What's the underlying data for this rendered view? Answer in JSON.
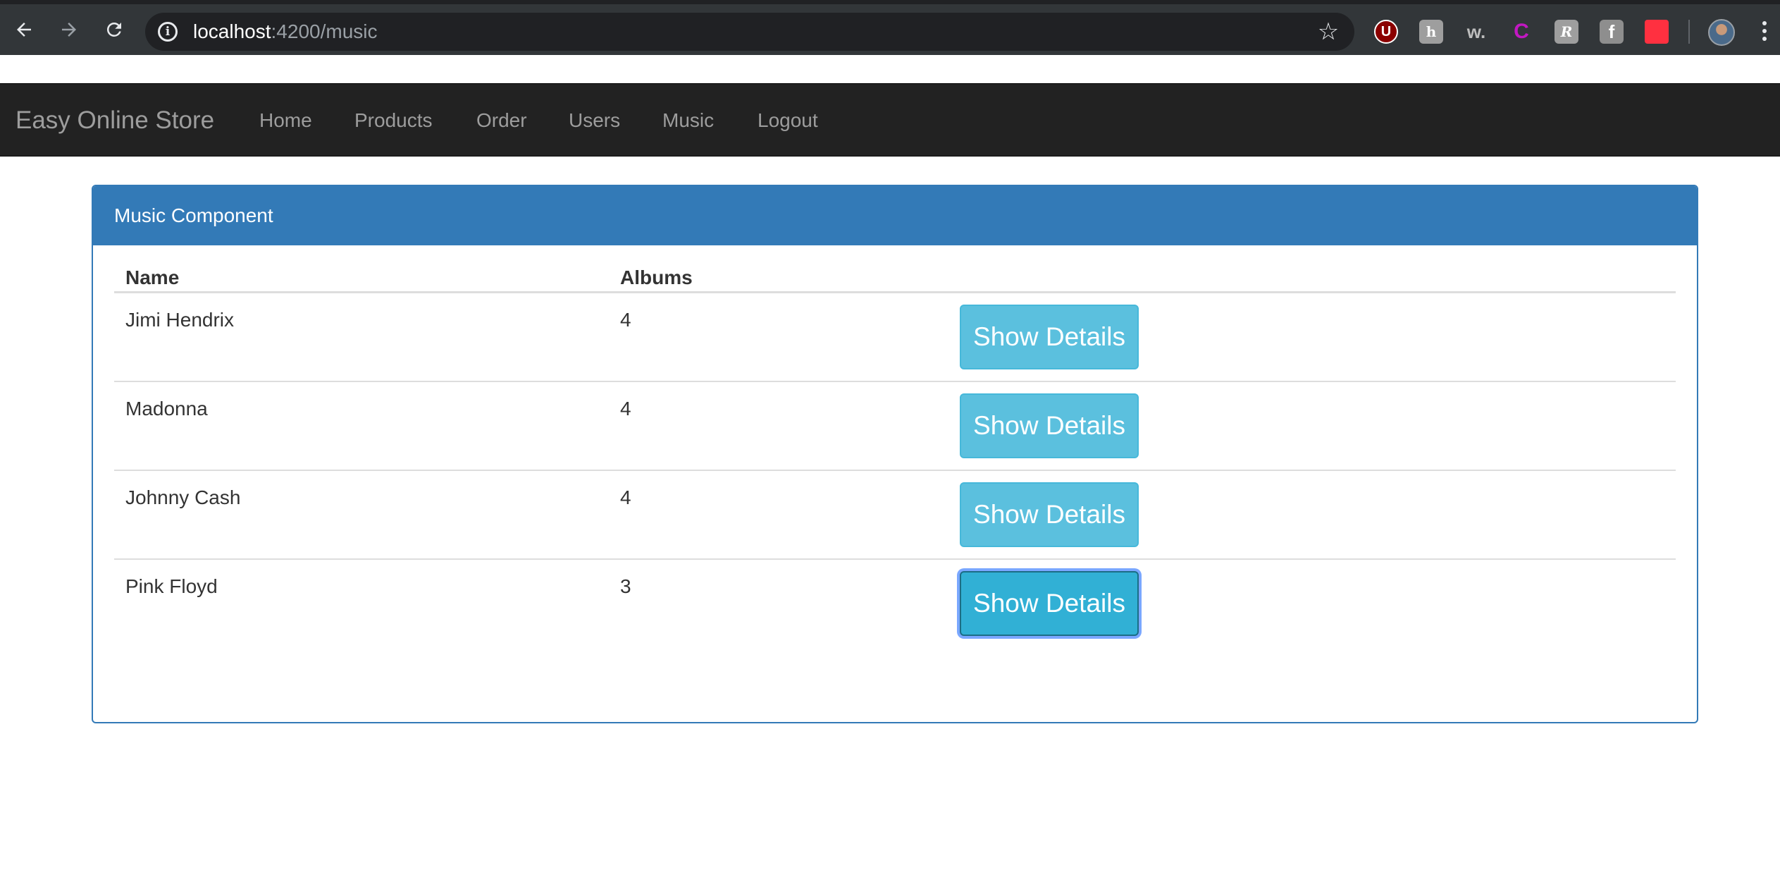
{
  "browser": {
    "url_host": "localhost",
    "url_rest": ":4200/music",
    "icons": [
      "back-arrow-icon",
      "forward-arrow-icon",
      "reload-icon",
      "info-icon",
      "bookmark-star-icon",
      "kebab-menu-icon"
    ],
    "extensions": [
      {
        "name": "ublock-extension-icon",
        "glyph": "U",
        "color": "#8b0000"
      },
      {
        "name": "h-extension-icon",
        "glyph": "h",
        "color": "#9e9e9e"
      },
      {
        "name": "w-extension-icon",
        "glyph": "w.",
        "color": "#323639"
      },
      {
        "name": "c-extension-icon",
        "glyph": "C",
        "color": "#323639"
      },
      {
        "name": "r-extension-icon",
        "glyph": "R",
        "color": "#9e9e9e"
      },
      {
        "name": "facebook-extension-icon",
        "glyph": "f",
        "color": "#8e8e8e"
      },
      {
        "name": "red-extension-icon",
        "glyph": "",
        "color": "#ff3040"
      }
    ]
  },
  "navbar": {
    "brand": "Easy Online Store",
    "links": [
      "Home",
      "Products",
      "Order",
      "Users",
      "Music",
      "Logout"
    ]
  },
  "panel": {
    "title": "Music Component",
    "columns": {
      "name": "Name",
      "albums": "Albums"
    },
    "rows": [
      {
        "name": "Jimi Hendrix",
        "albums": "4",
        "button": "Show Details"
      },
      {
        "name": "Madonna",
        "albums": "4",
        "button": "Show Details"
      },
      {
        "name": "Johnny Cash",
        "albums": "4",
        "button": "Show Details"
      },
      {
        "name": "Pink Floyd",
        "albums": "3",
        "button": "Show Details"
      }
    ]
  },
  "colors": {
    "panel_primary": "#337ab7",
    "button_info": "#5bc0de",
    "navbar_bg": "#222222"
  }
}
